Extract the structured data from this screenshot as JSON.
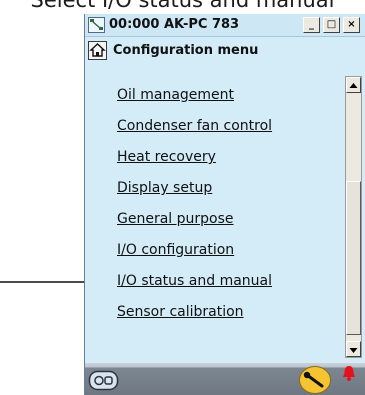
{
  "caption": "Select I/O status and manual",
  "window": {
    "title": "00:000 AK-PC 783",
    "buttons": {
      "minimize": "_",
      "maximize": "□",
      "close": "×"
    }
  },
  "header": {
    "title": "Configuration menu"
  },
  "menu": {
    "items": [
      "Oil management",
      "Condenser fan control",
      "Heat recovery",
      "Display setup",
      "General purpose",
      "I/O configuration",
      "I/O status and manual",
      "Sensor calibration"
    ]
  },
  "status": {
    "icons": [
      "controller-icon",
      "wrench-icon",
      "alarm-bell-icon"
    ],
    "colors": {
      "wrench_button": "#f5c433",
      "alarm": "#e8101c"
    }
  },
  "icons": {
    "app": "network-icon",
    "home": "home-icon",
    "scroll_up": "scroll-up-arrow-icon",
    "scroll_down": "scroll-down-arrow-icon",
    "pointer": "arrow-pointer-icon"
  }
}
